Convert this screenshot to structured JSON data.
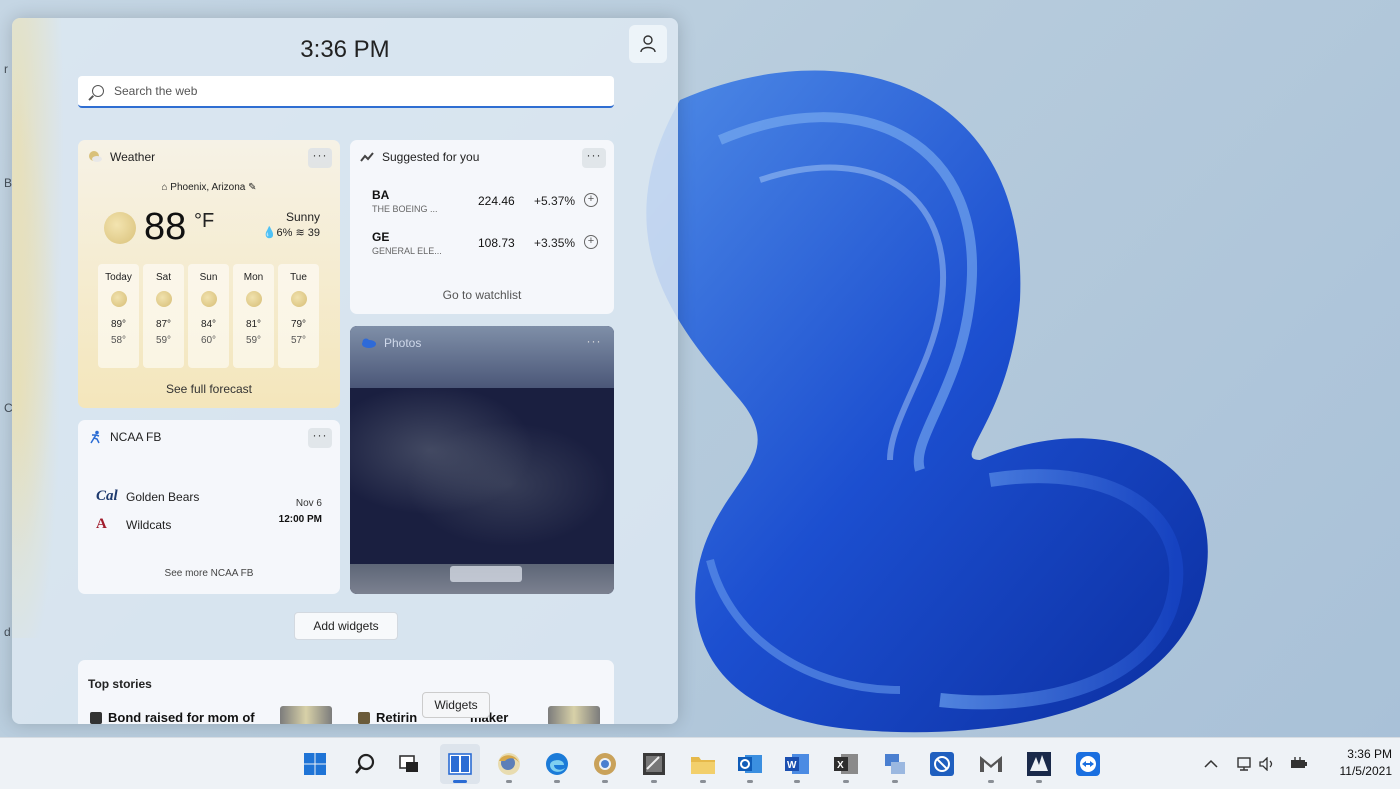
{
  "desktop": {
    "edge_letters": [
      "r",
      "B",
      "C",
      "d"
    ]
  },
  "widgets": {
    "time": "3:36 PM",
    "search_placeholder": "Search the web",
    "weather": {
      "title": "Weather",
      "location": "Phoenix, Arizona",
      "temp": "88",
      "unit": "°F",
      "condition": "Sunny",
      "precip": "6%",
      "aqi": "39",
      "forecast": [
        {
          "day": "Today",
          "hi": "89°",
          "lo": "58°"
        },
        {
          "day": "Sat",
          "hi": "87°",
          "lo": "59°"
        },
        {
          "day": "Sun",
          "hi": "84°",
          "lo": "60°"
        },
        {
          "day": "Mon",
          "hi": "81°",
          "lo": "59°"
        },
        {
          "day": "Tue",
          "hi": "79°",
          "lo": "57°"
        }
      ],
      "footer": "See full forecast"
    },
    "stocks": {
      "title": "Suggested for you",
      "rows": [
        {
          "symbol": "BA",
          "name": "THE BOEING ...",
          "price": "224.46",
          "change": "+5.37%"
        },
        {
          "symbol": "GE",
          "name": "GENERAL ELE...",
          "price": "108.73",
          "change": "+3.35%"
        }
      ],
      "footer": "Go to watchlist"
    },
    "photos": {
      "title": "Photos"
    },
    "ncaa": {
      "title": "NCAA FB",
      "teams": [
        {
          "logo": "Cal",
          "name": "Golden Bears"
        },
        {
          "logo": "A",
          "name": "Wildcats"
        }
      ],
      "date": "Nov 6",
      "time": "12:00 PM",
      "footer": "See more NCAA FB"
    },
    "add_label": "Add widgets",
    "top_stories": {
      "title": "Top stories",
      "items": [
        "Bond raised for mom of",
        "Retirin",
        "maker"
      ]
    },
    "more_label": "···"
  },
  "tooltip": "Widgets",
  "taskbar": {
    "icons": [
      "start-icon",
      "search-icon",
      "task-view-icon",
      "widgets-icon",
      "firefox-icon",
      "edge-icon",
      "chrome-icon",
      "tool-icon",
      "file-explorer-icon",
      "outlook-icon",
      "word-icon",
      "excel-icon",
      "network-app-icon",
      "blocked-app-icon",
      "gmail-icon",
      "ship-app-icon",
      "teamviewer-icon"
    ],
    "tray_time": "3:36 PM",
    "tray_date": "11/5/2021",
    "colors": {
      "accent": "#2b6cd4",
      "start_blue": "#1f74d6"
    }
  }
}
